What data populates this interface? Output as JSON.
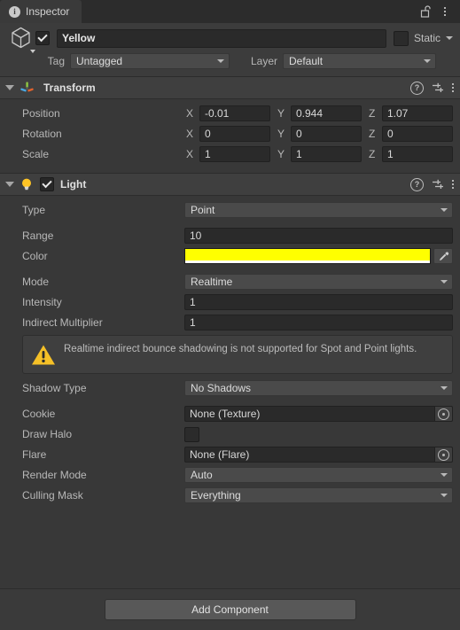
{
  "tab": {
    "label": "Inspector",
    "info_icon": "info-icon",
    "lock_icon": "lock-open-icon",
    "menu_icon": "kebab-menu-icon"
  },
  "gameobject": {
    "icon": "cube-icon",
    "enabled": true,
    "name": "Yellow",
    "name_placeholder": "Name",
    "static_checked": false,
    "static_label": "Static",
    "tag_label": "Tag",
    "tag_value": "Untagged",
    "layer_label": "Layer",
    "layer_value": "Default"
  },
  "transform": {
    "title": "Transform",
    "icon": "transform-gizmo-icon",
    "rows": [
      {
        "label": "Position",
        "x": "-0.01",
        "y": "0.944",
        "z": "1.07"
      },
      {
        "label": "Rotation",
        "x": "0",
        "y": "0",
        "z": "0"
      },
      {
        "label": "Scale",
        "x": "1",
        "y": "1",
        "z": "1"
      }
    ],
    "axes": {
      "x": "X",
      "y": "Y",
      "z": "Z"
    }
  },
  "light": {
    "title": "Light",
    "icon": "light-bulb-icon",
    "enabled": true,
    "type_label": "Type",
    "type_value": "Point",
    "range_label": "Range",
    "range_value": "10",
    "color_label": "Color",
    "color_value": "#FFFF00",
    "color_alpha": "#FFFFFF",
    "eyedropper_icon": "eyedropper-icon",
    "mode_label": "Mode",
    "mode_value": "Realtime",
    "intensity_label": "Intensity",
    "intensity_value": "1",
    "indirect_label": "Indirect Multiplier",
    "indirect_value": "1",
    "warning_icon": "warning-triangle-icon",
    "warning_text": "Realtime indirect bounce shadowing is not supported for Spot and Point lights.",
    "shadow_label": "Shadow Type",
    "shadow_value": "No Shadows",
    "cookie_label": "Cookie",
    "cookie_value": "None (Texture)",
    "drawhalo_label": "Draw Halo",
    "drawhalo_checked": false,
    "flare_label": "Flare",
    "flare_value": "None (Flare)",
    "rendermode_label": "Render Mode",
    "rendermode_value": "Auto",
    "culling_label": "Culling Mask",
    "culling_value": "Everything"
  },
  "footer": {
    "add_component_label": "Add Component"
  },
  "component_header_icons": {
    "help": "?",
    "preset": "preset-settings-icon",
    "menu": "kebab-menu-icon"
  }
}
